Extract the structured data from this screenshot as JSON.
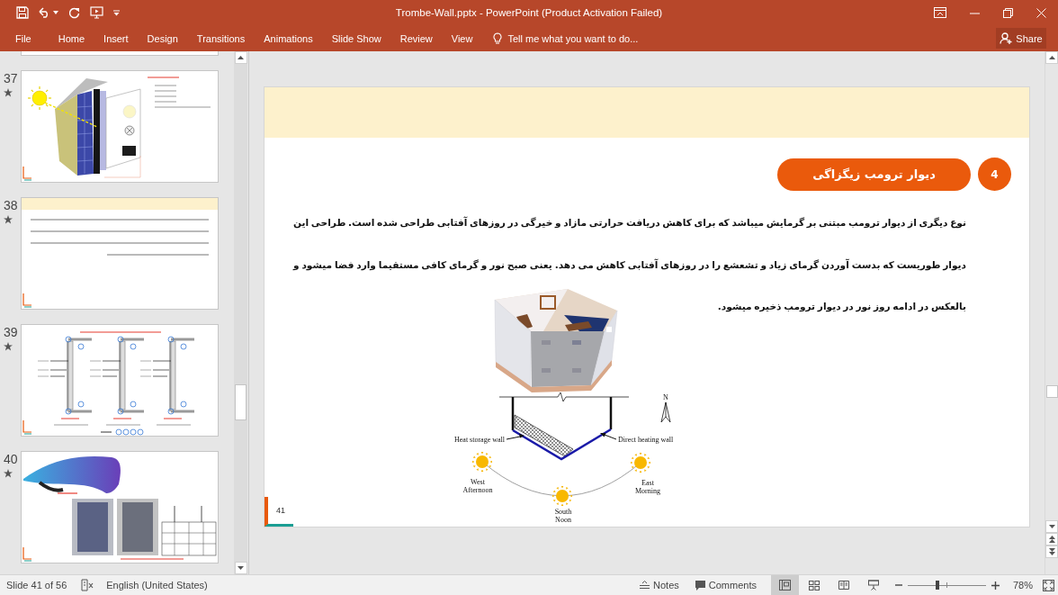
{
  "window": {
    "title": "Trombe-Wall.pptx - PowerPoint (Product Activation Failed)"
  },
  "ribbon": {
    "file_tab": "File",
    "tabs": [
      "Home",
      "Insert",
      "Design",
      "Transitions",
      "Animations",
      "Slide Show",
      "Review",
      "View"
    ],
    "tell_me": {
      "placeholder": "Tell me what you want to do..."
    },
    "share": "Share"
  },
  "thumbnails": [
    {
      "kind": "cut-off"
    },
    {
      "number": "37",
      "kind": "wall-illustration",
      "animated": true
    },
    {
      "number": "38",
      "kind": "text",
      "animated": true
    },
    {
      "number": "39",
      "kind": "wall-sections",
      "animated": true
    },
    {
      "number": "40",
      "kind": "panel-photos",
      "animated": true
    }
  ],
  "slide": {
    "section_number": "4",
    "section_title": "دیوار ترومب زیگزاگی",
    "paragraph": "نوع دیگری از دیوار ترومب مبتنی بر گرمایش میباشد که برای کاهش دریافت حرارتی مازاد و خیرگی در روزهای آفتابی طراحی شده است. طراحی این دیوار طوریست که بدست آوردن گرمای زیاد و تشعشع را در روزهای آفتابی کاهش می دهد. یعنی صبح نور و گرمای کافی مستقیما وارد فضا میشود و بالعکس در ادامه روز نور در دیوار ترومب ذخیره میشود.",
    "diagram": {
      "heat_storage_label": "Heat storage wall",
      "direct_heating_label": "Direct heating wall",
      "north": "N",
      "sun_positions": [
        {
          "direction": "West",
          "time": "Afternoon"
        },
        {
          "direction": "South",
          "time": "Noon"
        },
        {
          "direction": "East",
          "time": "Morning"
        }
      ]
    },
    "page_number": "41"
  },
  "status_bar": {
    "slide_info": "Slide 41 of 56",
    "language": "English (United States)",
    "notes": "Notes",
    "comments": "Comments",
    "views": [
      {
        "kind": "normal",
        "selected": true
      },
      {
        "kind": "sorter",
        "selected": false
      },
      {
        "kind": "reading",
        "selected": false
      },
      {
        "kind": "slideshow",
        "selected": false
      }
    ],
    "zoom": {
      "level": 0.38,
      "reading": "78%"
    }
  }
}
